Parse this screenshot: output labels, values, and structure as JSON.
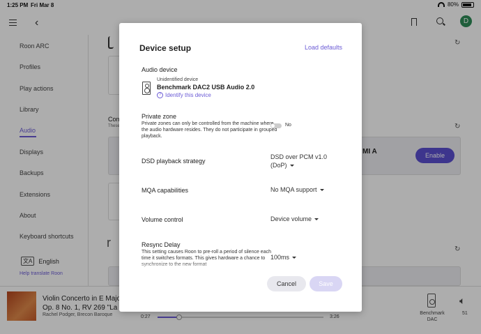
{
  "status_bar": {
    "time": "1:25 PM",
    "date": "Fri Mar 8",
    "battery": "80%"
  },
  "header": {
    "avatar_initial": "D"
  },
  "sidebar": {
    "items": [
      {
        "label": "Roon ARC"
      },
      {
        "label": "Profiles"
      },
      {
        "label": "Play actions"
      },
      {
        "label": "Library"
      },
      {
        "label": "Audio"
      },
      {
        "label": "Displays"
      },
      {
        "label": "Backups"
      },
      {
        "label": "Extensions"
      },
      {
        "label": "About"
      },
      {
        "label": "Keyboard shortcuts"
      }
    ],
    "active_item": "Audio",
    "language": "English",
    "help_link": "Help translate Roon"
  },
  "background": {
    "connected_label": "Con",
    "connected_sub": "These",
    "hdmi_label": "MI A",
    "enable_button": "Enable",
    "logo_fragment": "r",
    "hd_label": "HD3"
  },
  "player": {
    "track_line1": "Violin Concerto in E Majo",
    "track_line2": "Op. 8 No. 1, RV 269 \"La",
    "artist": "Rachel Podger, Brecon Baroque",
    "elapsed": "0:27",
    "total": "3:26",
    "progress_fraction": 0.13,
    "zone_label": "Benchmark DAC",
    "volume": "51"
  },
  "modal": {
    "title": "Device setup",
    "load_defaults": "Load defaults",
    "audio_device": {
      "label": "Audio device",
      "status": "Unidentified device",
      "name": "Benchmark DAC2 USB Audio 2.0",
      "identify_link": "Identify this device"
    },
    "private_zone": {
      "label": "Private zone",
      "description": "Private zones can only be controlled from the machine where the audio hardware resides. They do not participate in grouped playback.",
      "value": "No"
    },
    "dsd_strategy": {
      "label": "DSD playback strategy",
      "value": "DSD over PCM v1.0 (DoP)"
    },
    "mqa": {
      "label": "MQA capabilities",
      "value": "No MQA support"
    },
    "volume_control": {
      "label": "Volume control",
      "value": "Device volume"
    },
    "resync_delay": {
      "label": "Resync Delay",
      "description": "This setting causes Roon to pre-roll a period of silence each time it switches formats. This gives hardware a chance to synchronize to the new format",
      "value": "100ms"
    },
    "cancel_button": "Cancel",
    "save_button": "Save"
  },
  "colors": {
    "accent": "#6b5bd6",
    "enable": "#5b4fd0",
    "avatar": "#2e8b57"
  }
}
